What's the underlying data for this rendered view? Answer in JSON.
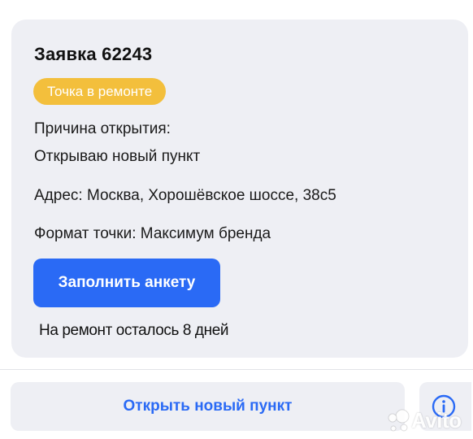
{
  "request": {
    "title": "Заявка 62243",
    "status": "Точка в ремонте",
    "reason_label": "Причина открытия:",
    "reason_value": "Открываю новый пункт",
    "address": "Адрес: Москва, Хорошёвское шоссе, 38с5",
    "format": "Формат точки: Максимум бренда",
    "fill_form_button": "Заполнить анкету",
    "repair_note": "На ремонт осталось 8 дней"
  },
  "footer": {
    "open_new_point_button": "Открыть новый пункт",
    "info_icon": "info-circle-icon"
  },
  "watermark": {
    "text": "Avito"
  },
  "colors": {
    "accent": "#2a6af5",
    "status_badge": "#f3bf3c",
    "card_background": "#eeeff4"
  }
}
